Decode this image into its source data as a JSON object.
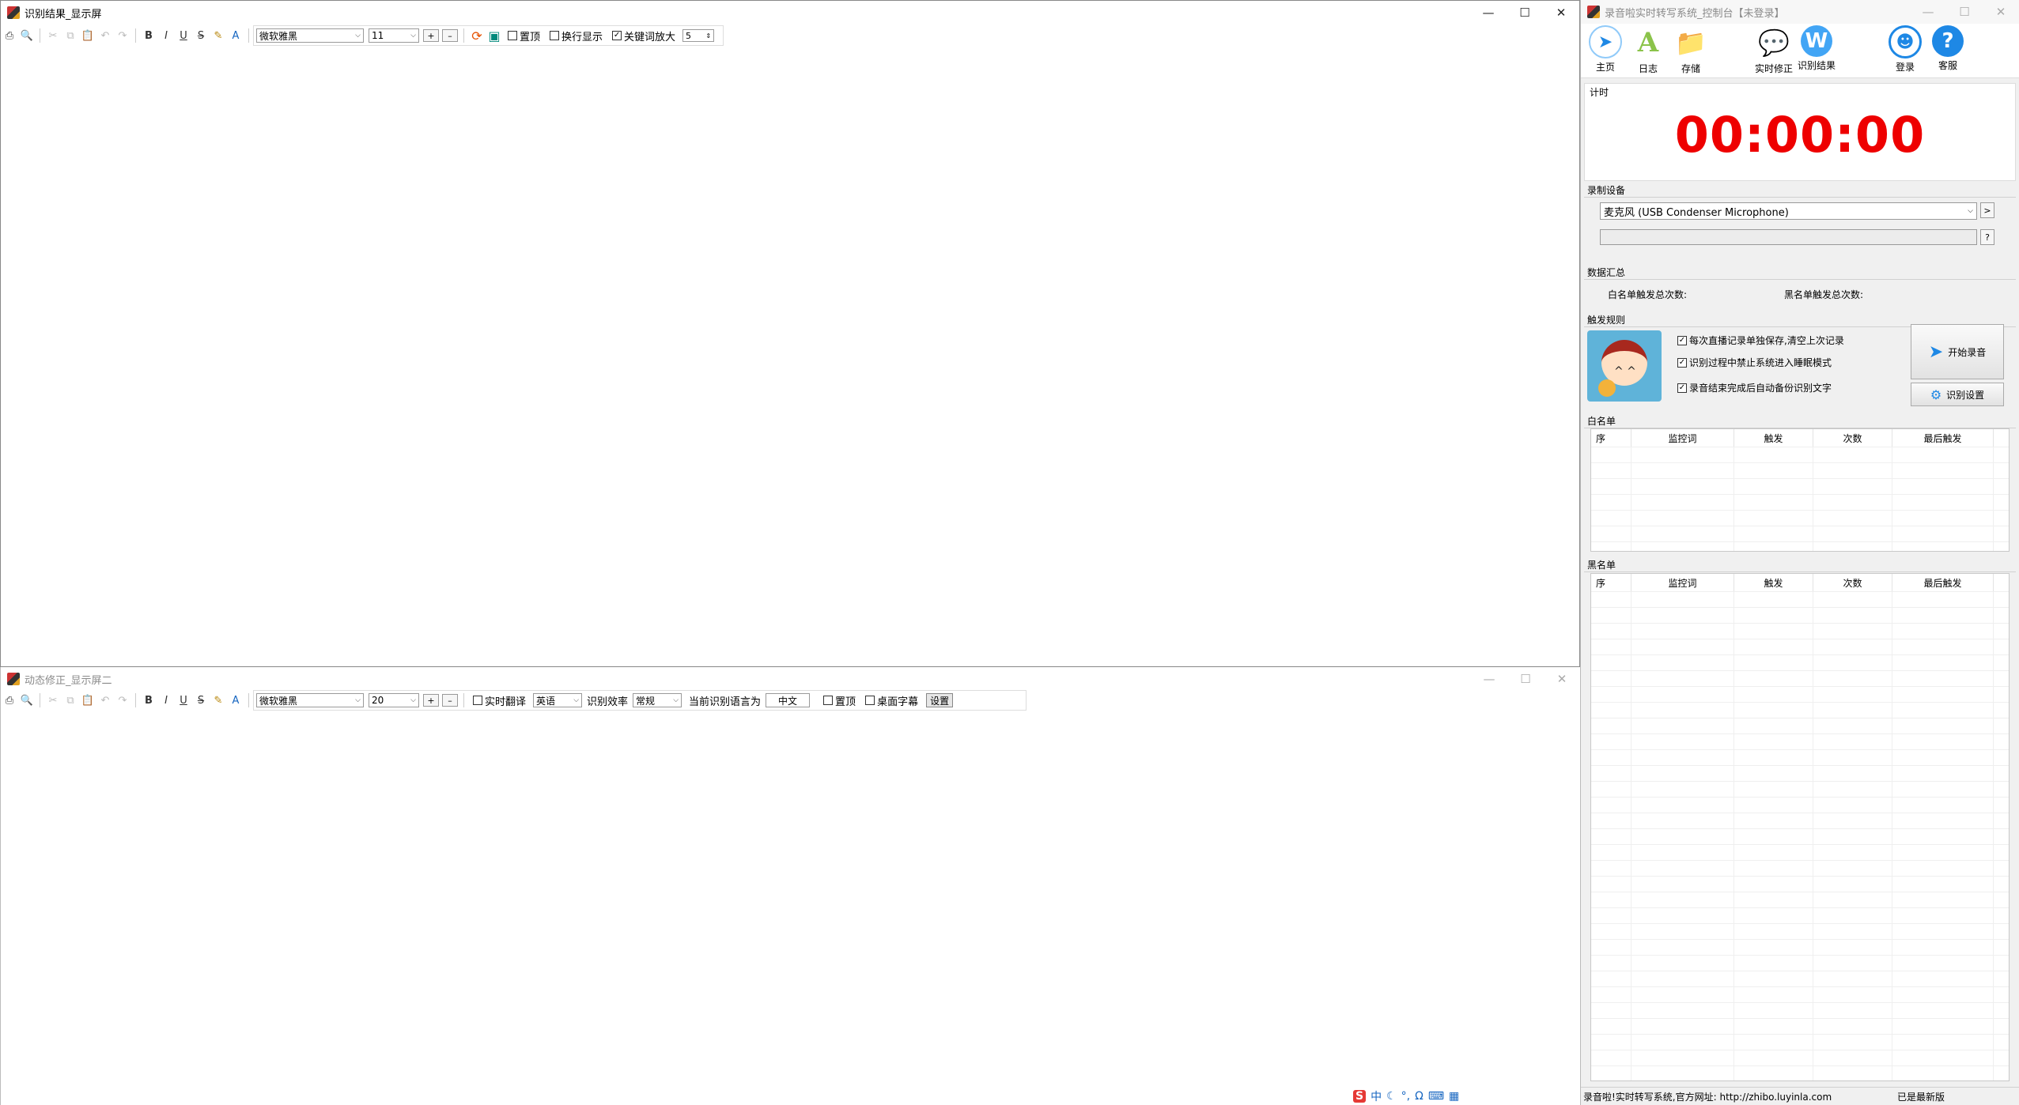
{
  "window1": {
    "title": "识别结果_显示屏",
    "font_name": "微软雅黑",
    "font_size": "11",
    "chk_pin": "置顶",
    "chk_wrap": "换行显示",
    "chk_keyword": "关键词放大",
    "keyword_scale": "5"
  },
  "window2": {
    "title": "动态修正_显示屏二",
    "font_name": "微软雅黑",
    "font_size": "20",
    "chk_translate": "实时翻译",
    "translate_lang": "英语",
    "efficiency_label": "识别效率",
    "efficiency_value": "常规",
    "current_lang_label": "当前识别语言为",
    "current_lang_value": "中文",
    "chk_pin": "置顶",
    "chk_subtitle": "桌面字幕",
    "settings_btn": "设置"
  },
  "control": {
    "title": "录音啦实时转写系统_控制台【未登录】",
    "toolbar": {
      "home": "主页",
      "log": "日志",
      "store": "存储",
      "correct": "实时修正",
      "result": "识别结果",
      "login": "登录",
      "service": "客服"
    },
    "timer_label": "计时",
    "timer_value": "00:00:00",
    "device_label": "录制设备",
    "device_value": "麦克风 (USB Condenser Microphone)",
    "summary_label": "数据汇总",
    "whitelist_total": "白名单触发总次数:",
    "blacklist_total": "黑名单触发总次数:",
    "rules_label": "触发规则",
    "rules": [
      "每次直播记录单独保存,清空上次记录",
      "识别过程中禁止系统进入睡眠模式",
      "录音结束完成后自动备份识别文字"
    ],
    "start_btn": "开始录音",
    "recog_settings_btn": "识别设置",
    "whitelist_label": "白名单",
    "blacklist_label": "黑名单",
    "columns": [
      "序",
      "监控词",
      "触发",
      "次数",
      "最后触发"
    ],
    "status_left": "录音啦!实时转写系统,官方网址: http://zhibo.luyinla.com",
    "status_right": "已是最新版"
  },
  "ime": {
    "lang": "中"
  },
  "colors": {
    "timer": "#ee0000",
    "accent": "#1e88e5"
  }
}
